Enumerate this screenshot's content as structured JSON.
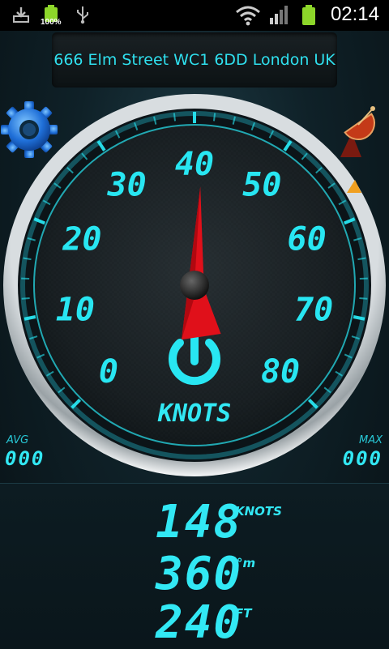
{
  "status_bar": {
    "battery_percent": "100%",
    "time": "02:14",
    "icons": [
      "download-icon",
      "battery-icon",
      "usb-icon",
      "wifi-icon",
      "signal-icon",
      "battery-icon"
    ]
  },
  "address": "666 Elm Street WC1 6DD London UK",
  "gauge": {
    "labels": [
      "0",
      "10",
      "20",
      "30",
      "40",
      "50",
      "60",
      "70",
      "80"
    ],
    "unit": "KNOTS",
    "needle_value": 41,
    "max": 80,
    "colors": {
      "accent": "#28e6f2",
      "needle": "#e0101a",
      "warning": "#f0a020"
    }
  },
  "stats": {
    "avg_label": "AVG",
    "avg_value": "000",
    "max_label": "MAX",
    "max_value": "000"
  },
  "readouts": {
    "speed": "148",
    "speed_unit": "KNOTS",
    "heading": "360",
    "heading_unit": "°m",
    "altitude": "240",
    "altitude_unit": "FT"
  }
}
